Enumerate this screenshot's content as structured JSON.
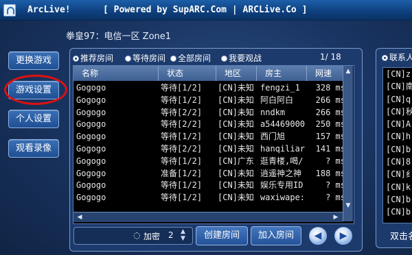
{
  "window": {
    "app_title": "ArcLive!",
    "powered_text": "[ Powered by SupARC.Com | ARCLive.Co ]"
  },
  "server_info": "拳皇97：电信一区 Zone1",
  "sidebar": {
    "items": [
      {
        "label": "更换游戏"
      },
      {
        "label": "游戏设置"
      },
      {
        "label": "个人设置"
      },
      {
        "label": "观看录像"
      }
    ],
    "highlight_color": "#e01010"
  },
  "room_panel": {
    "tabs": [
      {
        "label": "推荐房间",
        "selected": true
      },
      {
        "label": "等待房间",
        "selected": false
      },
      {
        "label": "全部房间",
        "selected": false
      },
      {
        "label": "我要观战",
        "selected": false
      }
    ],
    "page_indicator": "1/ 18",
    "columns": [
      "名称",
      "状态",
      "地区",
      "房主",
      "网速"
    ],
    "rows": [
      [
        "Gogogo",
        "等待[1/2]",
        "[CN]未知",
        "fengzi_1",
        "328 ms"
      ],
      [
        "Gogogo",
        "等待[1/2]",
        "[CN]未知",
        "阿白阿白",
        "266 ms"
      ],
      [
        "Gogogo",
        "等待[2/2]",
        "[CN]未知",
        "nndkm",
        "266 ms"
      ],
      [
        "Gogogo",
        "等待[2/2]",
        "[CN]未知",
        "a54469000",
        "250 ms"
      ],
      [
        "Gogogo",
        "等待[1/2]",
        "[CN]未知",
        "西门旭",
        "157 ms"
      ],
      [
        "Gogogo",
        "等待[2/2]",
        "[CN]未知",
        "hanqiliar",
        "141 ms"
      ],
      [
        "Gogogo",
        "等待[1/2]",
        "[CN]广东",
        "逛青楼,喝/",
        "? ms"
      ],
      [
        "Gogogo",
        "准备[1/2]",
        "[CN]未知",
        "逍遥神之神",
        "188 ms"
      ],
      [
        "Gogogo",
        "等待[1/2]",
        "[CN]未知",
        "娱乐专用ID",
        "? ms"
      ],
      [
        "Gogogo",
        "等待[1/2]",
        "[CN]未知",
        "waxiwape:",
        "? ms"
      ]
    ],
    "password_label": "加密",
    "password_value": "2",
    "create_button": "创建房间",
    "join_button": "加入房间",
    "prev_icon": "arrow-left-icon",
    "next_icon": "arrow-right-icon"
  },
  "contacts_panel": {
    "title": "联系人",
    "items": [
      "[CN]z",
      "[CN]南",
      "[CN]q",
      "[CN]秋",
      "[CN]A",
      "[CN]h",
      "[CN]b",
      "[CN]8",
      "[CN]纟",
      "[CN]k",
      "[CN]b",
      "[CN]b"
    ],
    "footer": "双击名"
  },
  "colors": {
    "title_bar": "#0e3f7c",
    "panel_bg": "#1c3a6c",
    "list_bg": "#000000",
    "button_blue": "#24539a"
  }
}
